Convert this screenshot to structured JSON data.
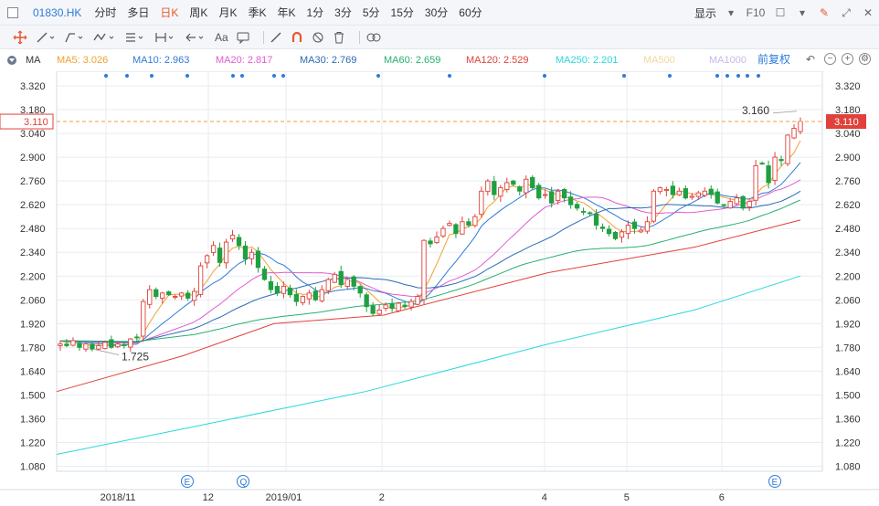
{
  "header": {
    "stock_code": "01830.HK",
    "periods": [
      "分时",
      "多日",
      "日K",
      "周K",
      "月K",
      "季K",
      "年K",
      "1分",
      "3分",
      "5分",
      "15分",
      "30分",
      "60分"
    ],
    "active_period": "日K",
    "display_label": "显示",
    "f10_label": "F10"
  },
  "drawing_tools": {
    "text_tool_label": "Aa"
  },
  "ma_bar": {
    "label": "MA",
    "items": [
      {
        "label": "MA5: 3.026",
        "color": "#f0a030"
      },
      {
        "label": "MA10: 2.963",
        "color": "#2d7bd8"
      },
      {
        "label": "MA20: 2.817",
        "color": "#e05cd0"
      },
      {
        "label": "MA30: 2.769",
        "color": "#2a6ab5"
      },
      {
        "label": "MA60: 2.659",
        "color": "#28b070"
      },
      {
        "label": "MA120: 2.529",
        "color": "#e0413b"
      },
      {
        "label": "MA250: 2.201",
        "color": "#2ad8d8"
      },
      {
        "label": "MA500",
        "color": "#f2d7a0"
      },
      {
        "label": "MA1000",
        "color": "#c8b8ec"
      }
    ],
    "adjust_label": "前复权"
  },
  "chart_data": {
    "type": "candlestick",
    "y_ticks": [
      "3.320",
      "3.180",
      "3.040",
      "2.900",
      "2.760",
      "2.620",
      "2.480",
      "2.340",
      "2.200",
      "2.060",
      "1.920",
      "1.780",
      "1.640",
      "1.500",
      "1.360",
      "1.220",
      "1.080"
    ],
    "ylim": [
      1.08,
      3.32
    ],
    "x_labels": [
      "2018/11",
      "12",
      "2019/01",
      "2",
      "4",
      "5",
      "6"
    ],
    "last_price": "3.110",
    "high_annotation": "3.160",
    "low_annotation": "1.725",
    "event_markers": [
      "E",
      "Q",
      "E"
    ],
    "ma_latest": {
      "MA5": 3.026,
      "MA10": 2.963,
      "MA20": 2.817,
      "MA30": 2.769,
      "MA60": 2.659,
      "MA120": 2.529,
      "MA250": 2.201
    },
    "closes": [
      1.8,
      1.79,
      1.82,
      1.78,
      1.8,
      1.77,
      1.79,
      1.81,
      1.78,
      1.8,
      1.79,
      1.83,
      1.84,
      2.05,
      2.12,
      2.08,
      2.1,
      2.09,
      2.08,
      2.1,
      2.07,
      2.11,
      2.26,
      2.32,
      2.38,
      2.28,
      2.4,
      2.44,
      2.38,
      2.3,
      2.34,
      2.25,
      2.18,
      2.12,
      2.1,
      2.14,
      2.09,
      2.05,
      2.08,
      2.1,
      2.06,
      2.12,
      2.18,
      2.21,
      2.15,
      2.18,
      2.14,
      2.1,
      2.02,
      1.98,
      2.0,
      2.03,
      2.01,
      2.04,
      2.02,
      2.05,
      2.08,
      2.41,
      2.39,
      2.43,
      2.48,
      2.51,
      2.45,
      2.52,
      2.5,
      2.55,
      2.7,
      2.76,
      2.68,
      2.72,
      2.75,
      2.74,
      2.7,
      2.77,
      2.72,
      2.66,
      2.68,
      2.63,
      2.7,
      2.66,
      2.62,
      2.6,
      2.58,
      2.57,
      2.5,
      2.48,
      2.45,
      2.42,
      2.46,
      2.5,
      2.48,
      2.47,
      2.52,
      2.7,
      2.72,
      2.71,
      2.68,
      2.7,
      2.66,
      2.67,
      2.69,
      2.7,
      2.68,
      2.63,
      2.62,
      2.64,
      2.66,
      2.6,
      2.64,
      2.85,
      2.86,
      2.75,
      2.9,
      2.88,
      3.03,
      3.07,
      3.11
    ]
  }
}
